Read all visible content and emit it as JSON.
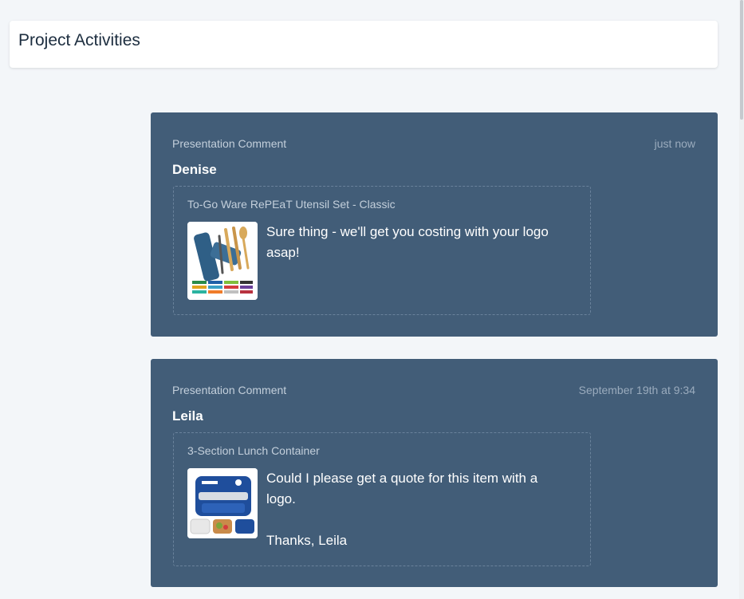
{
  "header": {
    "title": "Project Activities"
  },
  "activities": [
    {
      "type": "Presentation Comment",
      "time": "just now",
      "author": "Denise",
      "product": "To-Go Ware RePEaT Utensil Set - Classic",
      "product_image_icon": "utensil-set-image",
      "comment": "Sure thing - we'll get you costing with your logo asap!"
    },
    {
      "type": "Presentation Comment",
      "time": "September 19th at 9:34",
      "author": "Leila",
      "product": "3-Section Lunch Container",
      "product_image_icon": "lunch-container-image",
      "comment": "Could I please get a quote for this item with a logo.\n\nThanks, Leila"
    }
  ],
  "colors": {
    "background": "#f3f6f9",
    "card": "#425d78",
    "header_card": "#ffffff",
    "title_text": "#1c2d3f",
    "muted_text": "#c3cfdb",
    "time_text": "#9aabbd"
  }
}
